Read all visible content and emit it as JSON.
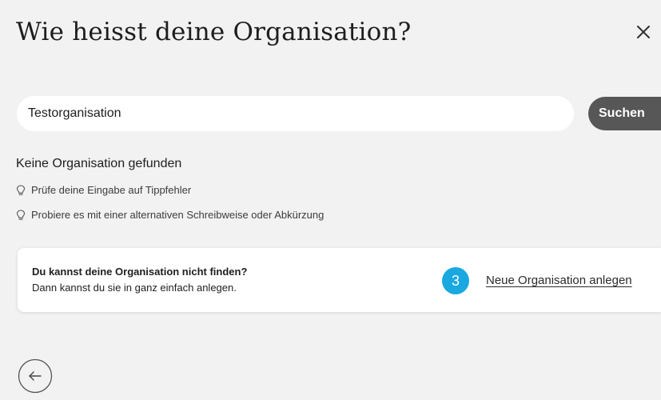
{
  "dialog": {
    "title": "Wie heisst deine Organisation?"
  },
  "search": {
    "value": "Testorganisation",
    "button_label": "Suchen"
  },
  "results": {
    "heading": "Keine Organisation gefunden",
    "tips": [
      "Prüfe deine Eingabe auf Tippfehler",
      "Probiere es mit einer alternativen Schreibweise oder Abkürzung"
    ]
  },
  "not_found_card": {
    "title": "Du kannst deine Organisation nicht finden?",
    "subtitle": "Dann kannst du sie in ganz einfach anlegen.",
    "step_number": "3",
    "link_label": "Neue Organisation anlegen"
  },
  "icons": {
    "close": "close-icon",
    "tip": "lightbulb-icon",
    "back": "arrow-left-icon"
  },
  "colors": {
    "background": "#f2f2f2",
    "search_button": "#575757",
    "step_badge": "#19a8e0"
  }
}
